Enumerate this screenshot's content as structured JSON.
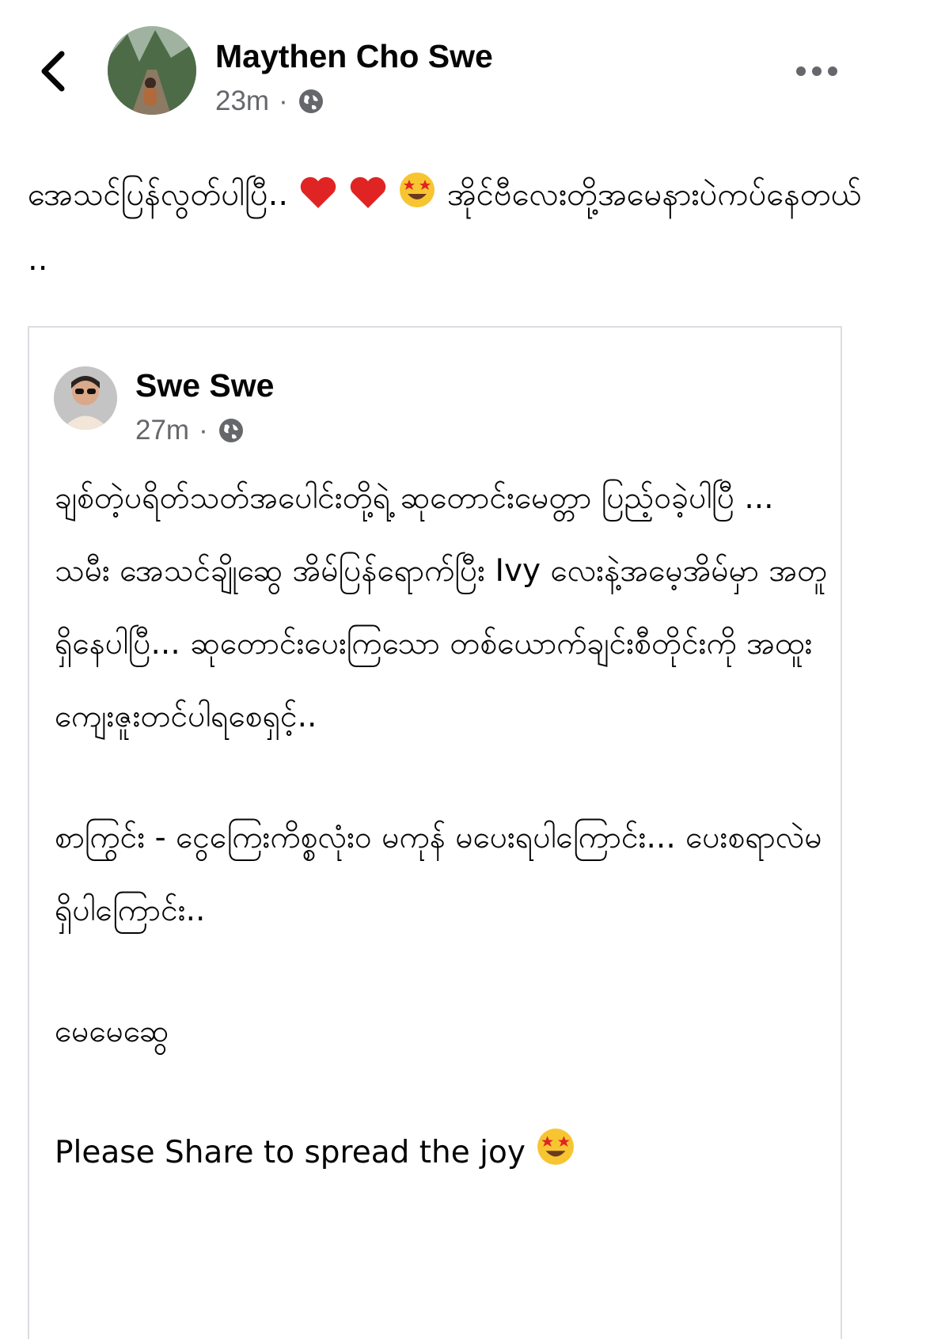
{
  "header": {
    "author": "Maythen Cho Swe",
    "time": "23m",
    "separator": "·"
  },
  "post": {
    "text_part1": "အေသင်ပြန်လွတ်ပါပြီ..",
    "text_part2": "အိုင်ဗီလေးတို့အမေနားပဲကပ်နေတယ် .."
  },
  "shared": {
    "author": "Swe Swe",
    "time": "27m",
    "separator": "·",
    "paragraph1": "ချစ်တဲ့ပရိတ်သတ်အပေါင်းတို့ရဲ့ ဆုတောင်းမေတ္တာ ပြည့်ဝခဲ့ပါပြီ ... သမီး အေသင်ချိုဆွေ အိမ်ပြန်ရောက်ပြီး Ivy လေးနဲ့အမေ့အိမ်မှာ အတူရှိနေပါပြီ... ဆုတောင်းပေးကြသော တစ်ယောက်ချင်းစီတိုင်းကို အထူးကျေးဇူးတင်ပါရစေရှင့်..",
    "paragraph2": "စာကြွင်း - ငွေကြေးကိစ္စလုံးဝ မကုန် မပေးရပါကြောင်း... ပေးစရာလဲမရှိပါကြောင်း..",
    "signature": "မေမေဆွေ",
    "closing": "Please Share to spread the joy"
  },
  "colors": {
    "text": "#050505",
    "meta": "#65676b",
    "heart": "#e02424",
    "border": "#dadde1"
  },
  "icons": [
    "chevron-left-icon",
    "globe-icon",
    "more-options-icon",
    "heart-emoji",
    "star-struck-emoji"
  ]
}
